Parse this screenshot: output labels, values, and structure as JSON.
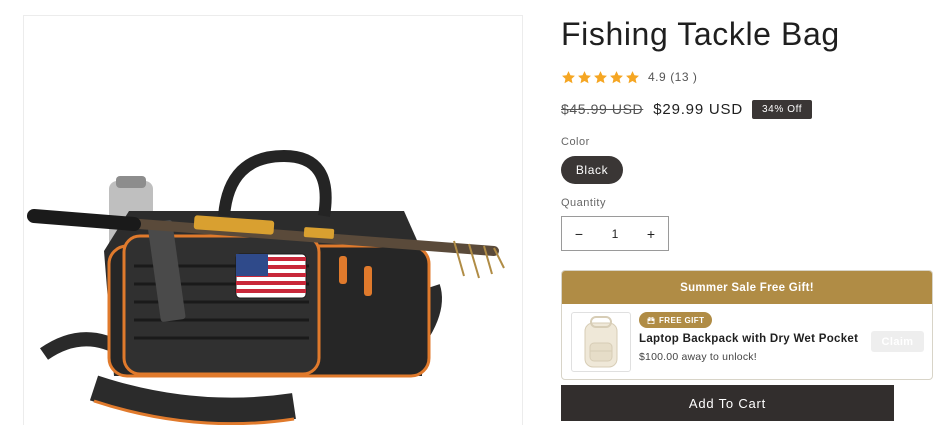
{
  "product": {
    "title": "Fishing Tackle Bag",
    "rating_value": "4.9",
    "rating_count": "(13 )",
    "stars": 5,
    "price_original": "$45.99 USD",
    "price_sale": "$29.99 USD",
    "discount_badge": "34% Off"
  },
  "variant": {
    "color_label": "Color",
    "color_selected": "Black"
  },
  "quantity": {
    "label": "Quantity",
    "value": "1",
    "decrease_symbol": "−",
    "increase_symbol": "+"
  },
  "gift": {
    "header": "Summer Sale Free Gift!",
    "tag": "FREE GIFT",
    "name": "Laptop Backpack with Dry Wet Pocket",
    "subtitle": "$100.00 away to unlock!",
    "claim_label": "Claim"
  },
  "cart": {
    "add_label": "Add To Cart"
  },
  "colors": {
    "star": "#f5a623",
    "gold": "#b08c45",
    "dark": "#322e2d"
  },
  "icons": {
    "star": "star-icon",
    "gift": "gift-icon",
    "minus": "minus-icon",
    "plus": "plus-icon"
  }
}
